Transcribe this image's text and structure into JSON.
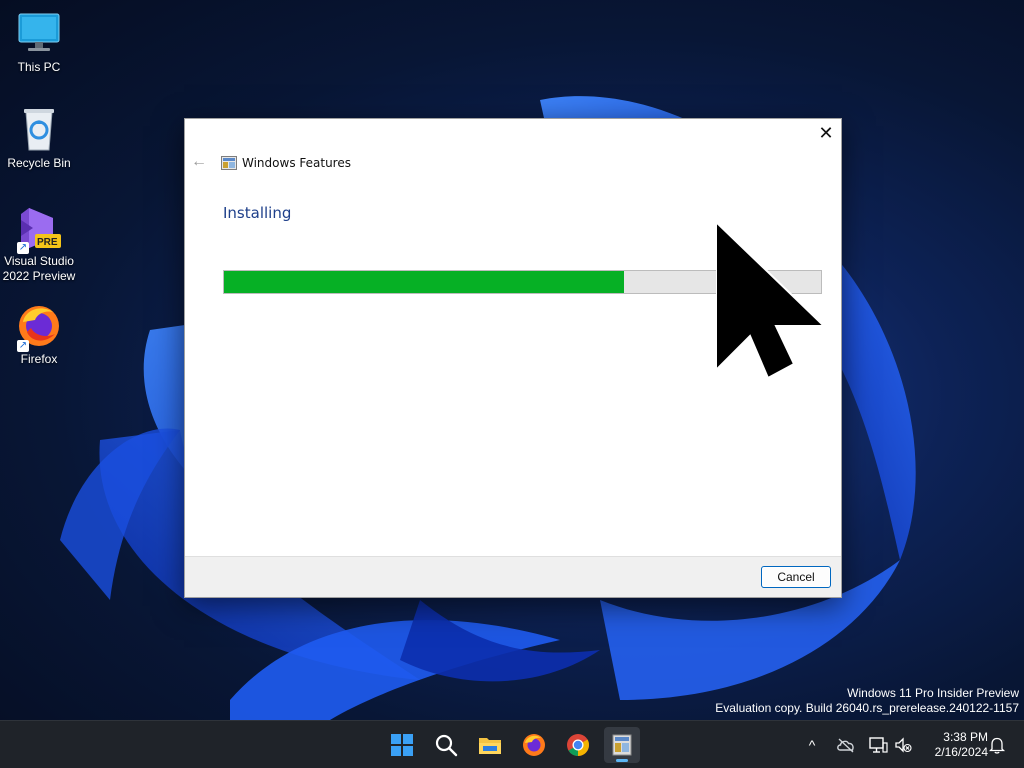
{
  "desktop": {
    "icons": [
      {
        "label": "This PC"
      },
      {
        "label": "Recycle Bin"
      },
      {
        "label": "Visual Studio 2022 Preview",
        "badge": "PRE"
      },
      {
        "label": "Firefox"
      }
    ]
  },
  "dialog": {
    "title": "Windows Features",
    "heading": "Installing",
    "progress_fraction": 0.67,
    "progress_color": "#06b025",
    "cancel_label": "Cancel",
    "close_glyph": "✕",
    "back_glyph": "←"
  },
  "watermark": {
    "line1": "Windows 11 Pro Insider Preview",
    "line2": "Evaluation copy. Build 26040.rs_prerelease.240122-1157"
  },
  "taskbar": {
    "apps": [
      "start-icon",
      "search-icon",
      "file-explorer-icon",
      "firefox-icon",
      "chrome-icon",
      "windows-features-icon"
    ],
    "tray_expand_glyph": "^",
    "clock": {
      "time": "3:38 PM",
      "date": "2/16/2024"
    }
  }
}
